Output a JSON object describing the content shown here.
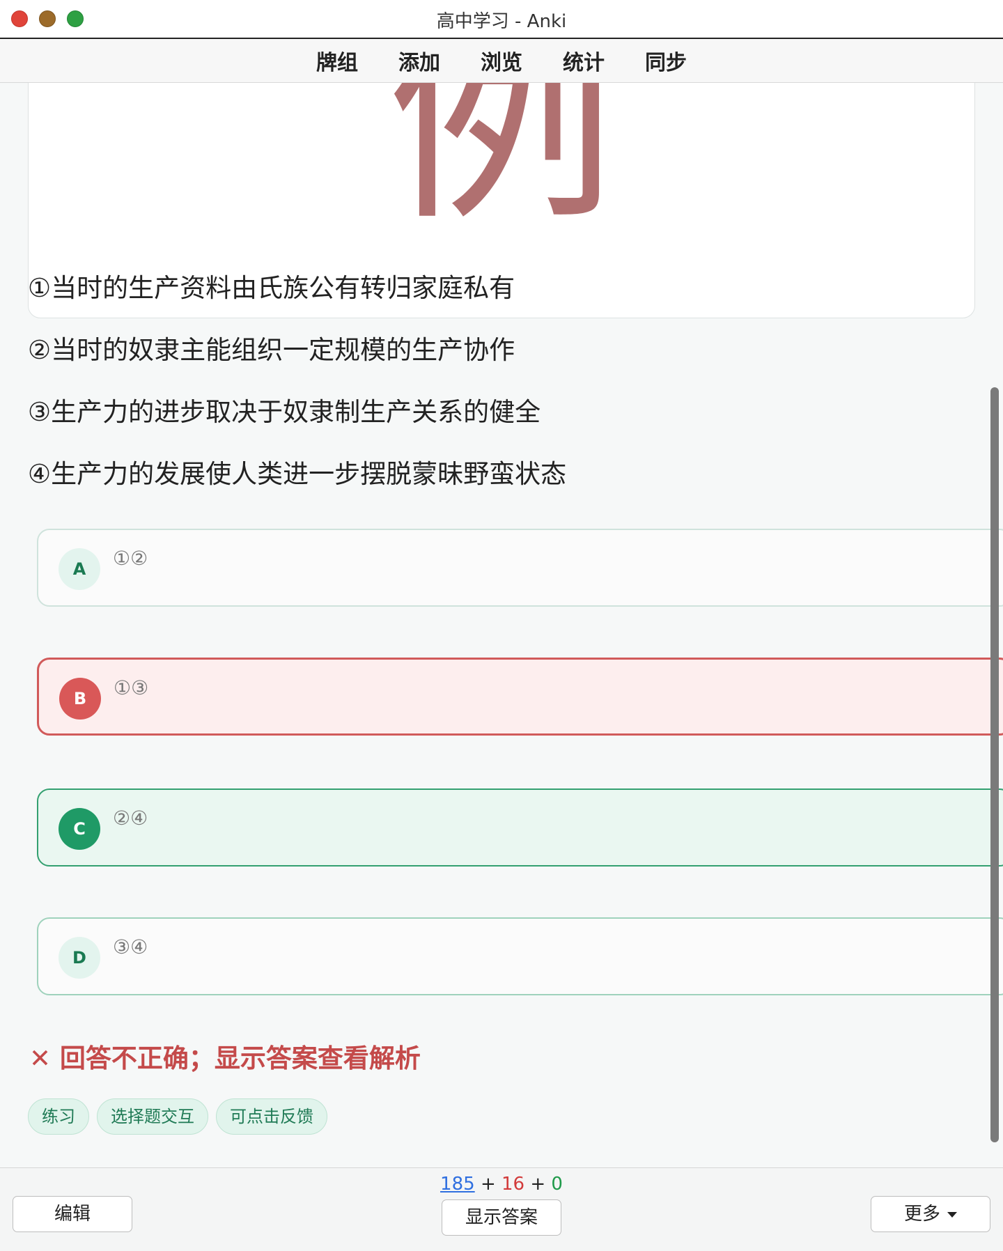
{
  "window": {
    "title": "高中学习 - Anki"
  },
  "menu": {
    "items": [
      "牌组",
      "添加",
      "浏览",
      "统计",
      "同步"
    ]
  },
  "card": {
    "big_char": "例",
    "statements": [
      "①当时的生产资料由氏族公有转归家庭私有",
      "②当时的奴隶主能组织一定规模的生产协作",
      "③生产力的进步取决于奴隶制生产关系的健全",
      "④生产力的发展使人类进一步摆脱蒙昧野蛮状态"
    ],
    "options": [
      {
        "letter": "A",
        "text": "①②",
        "state": "neutral"
      },
      {
        "letter": "B",
        "text": "①③",
        "state": "wrong"
      },
      {
        "letter": "C",
        "text": "②④",
        "state": "correct"
      },
      {
        "letter": "D",
        "text": "③④",
        "state": "neutral"
      }
    ],
    "result": "✕ 回答不正确；显示答案查看解析",
    "tags": [
      "练习",
      "选择题交互",
      "可点击反馈"
    ]
  },
  "bottombar": {
    "count_new": "185",
    "count_learn": "16",
    "count_review": "0",
    "plus": "+",
    "edit_label": "编辑",
    "show_answer_label": "显示答案",
    "more_label": "更多"
  },
  "colors": {
    "wrong": "#d95858",
    "correct": "#1f9a66",
    "new_count": "#2f6fe0",
    "learn_count": "#d23a3a",
    "review_count": "#1f9a4a"
  }
}
